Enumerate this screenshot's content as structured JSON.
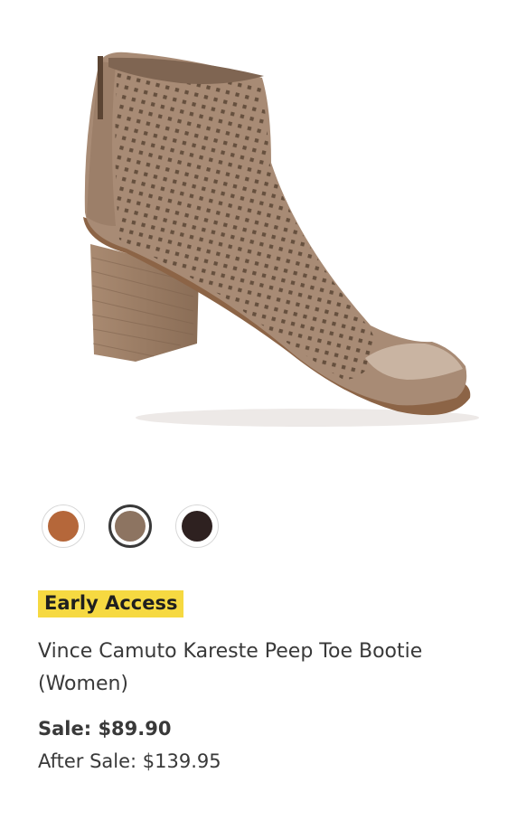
{
  "product": {
    "badge": "Early Access",
    "title": "Vince Camuto Kareste Peep Toe Bootie (Women)",
    "sale_price": "Sale: $89.90",
    "after_sale_price": "After Sale: $139.95"
  },
  "swatches": [
    {
      "color": "#b5673a",
      "selected": false
    },
    {
      "color": "#8d7461",
      "selected": true
    },
    {
      "color": "#2e2120",
      "selected": false
    }
  ]
}
